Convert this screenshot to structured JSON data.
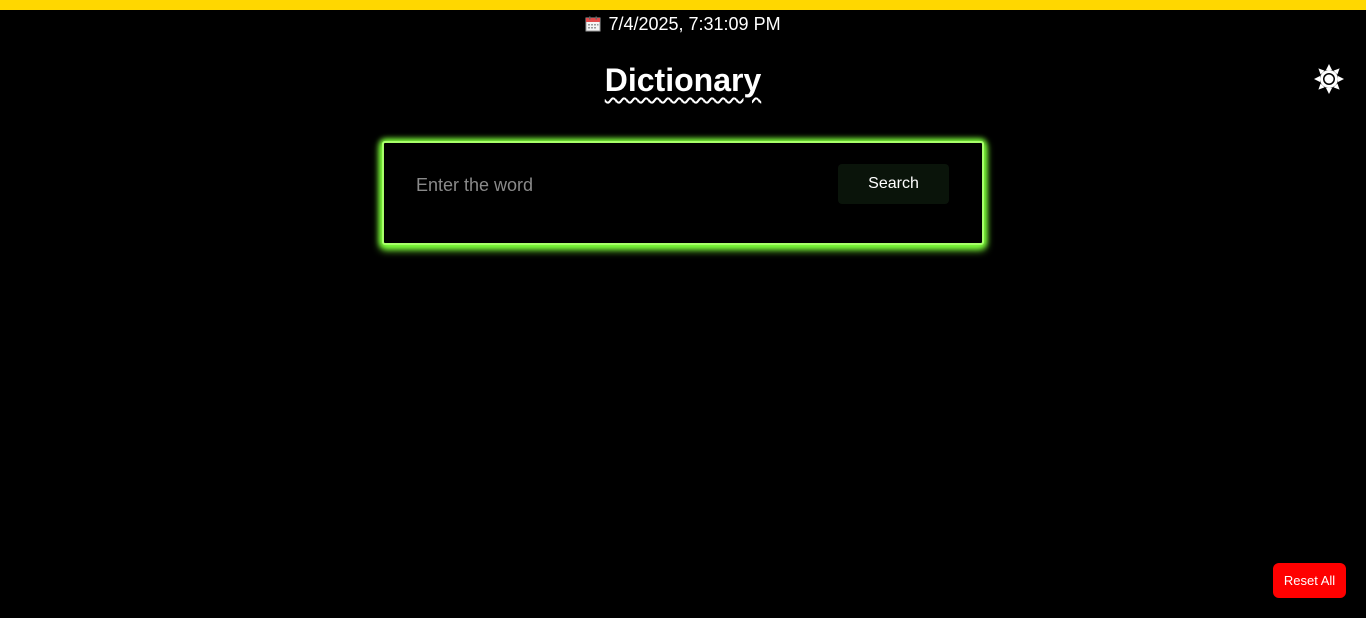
{
  "header": {
    "datetime": "7/4/2025, 7:31:09 PM",
    "datetime_icon": "calendar-icon",
    "title": "Dictionary",
    "theme_toggle_icon": "sun-icon"
  },
  "search": {
    "placeholder": "Enter the word",
    "value": "",
    "button_label": "Search"
  },
  "footer": {
    "reset_label": "Reset All"
  },
  "colors": {
    "background": "#000000",
    "top_bar": "#ffd700",
    "search_glow": "#a8ff6a",
    "reset_button": "#ff0000"
  }
}
